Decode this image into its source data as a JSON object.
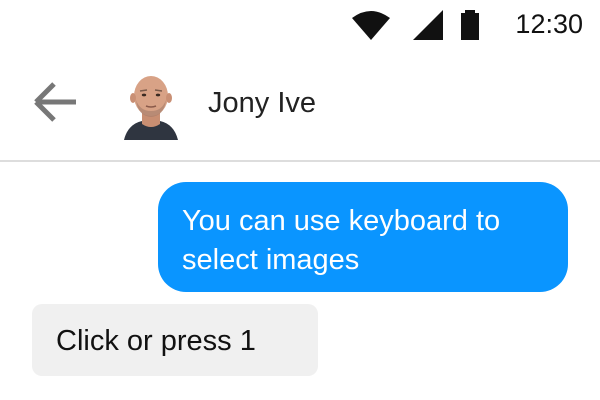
{
  "status_bar": {
    "time": "12:30",
    "icons": [
      "wifi-icon",
      "signal-icon",
      "battery-icon"
    ]
  },
  "header": {
    "back_icon": "arrow-left-icon",
    "contact_name": "Jony Ive"
  },
  "messages": [
    {
      "direction": "outgoing",
      "text": "You can use keyboard to select images",
      "color": "#0a95ff"
    },
    {
      "direction": "incoming",
      "text": "Click or press 1",
      "color": "#f0f0f0"
    }
  ]
}
